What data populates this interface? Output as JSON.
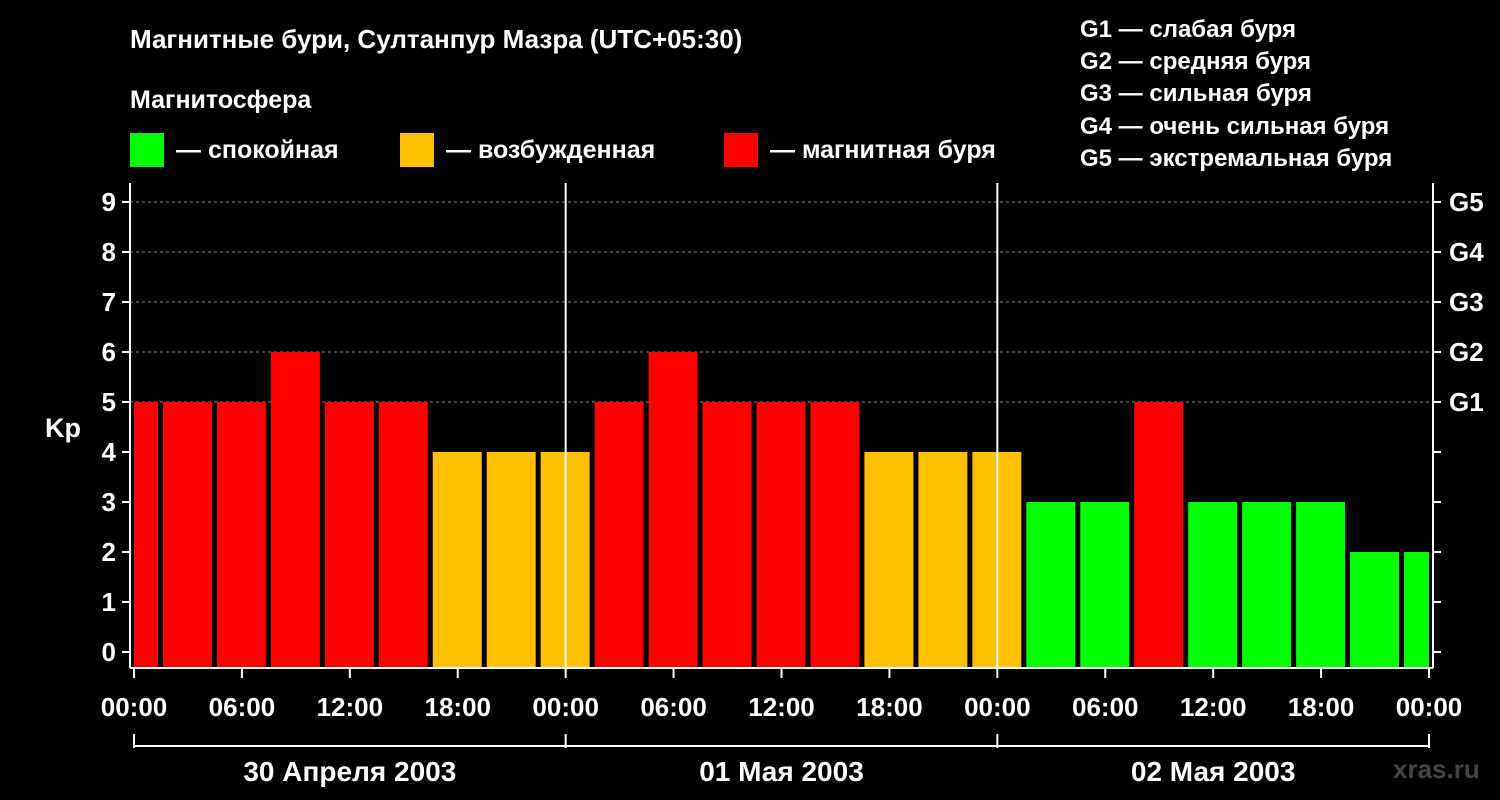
{
  "title": "Магнитные бури, Султанпур Мазра (UTC+05:30)",
  "magnetosphere_label": "Магнитосфера",
  "legend": [
    {
      "label": "— спокойная",
      "color": "#00ff00"
    },
    {
      "label": "— возбужденная",
      "color": "#ffc000"
    },
    {
      "label": "— магнитная буря",
      "color": "#ff0000"
    }
  ],
  "g_scale": [
    "G1 — слабая буря",
    "G2 — средняя буря",
    "G3 — сильная буря",
    "G4 — очень сильная буря",
    "G5 — экстремальная буря"
  ],
  "watermark": "xras.ru",
  "chart_data": {
    "type": "bar",
    "ylabel": "Kp",
    "ylim": [
      0,
      9
    ],
    "y_ticks": [
      0,
      1,
      2,
      3,
      4,
      5,
      6,
      7,
      8,
      9
    ],
    "right_axis_labels": [
      {
        "kp": 5,
        "label": "G1"
      },
      {
        "kp": 6,
        "label": "G2"
      },
      {
        "kp": 7,
        "label": "G3"
      },
      {
        "kp": 8,
        "label": "G4"
      },
      {
        "kp": 9,
        "label": "G5"
      }
    ],
    "x_tick_labels": [
      "00:00",
      "06:00",
      "12:00",
      "18:00",
      "00:00",
      "06:00",
      "12:00",
      "18:00",
      "00:00",
      "06:00",
      "12:00",
      "18:00",
      "00:00"
    ],
    "days": [
      "30 Апреля 2003",
      "01 Мая 2003",
      "02 Мая 2003"
    ],
    "grid": "dashed horizontal at Kp 5-9",
    "colors": {
      "quiet": "#00ff00",
      "active": "#ffc000",
      "storm": "#ff0000"
    },
    "bars": [
      {
        "start_hour": 0,
        "end_hour": 1.5,
        "kp": 5
      },
      {
        "start_hour": 1.5,
        "end_hour": 4.5,
        "kp": 5
      },
      {
        "start_hour": 4.5,
        "end_hour": 7.5,
        "kp": 5
      },
      {
        "start_hour": 7.5,
        "end_hour": 10.5,
        "kp": 6
      },
      {
        "start_hour": 10.5,
        "end_hour": 13.5,
        "kp": 5
      },
      {
        "start_hour": 13.5,
        "end_hour": 16.5,
        "kp": 5
      },
      {
        "start_hour": 16.5,
        "end_hour": 19.5,
        "kp": 4
      },
      {
        "start_hour": 19.5,
        "end_hour": 22.5,
        "kp": 4
      },
      {
        "start_hour": 22.5,
        "end_hour": 25.5,
        "kp": 4
      },
      {
        "start_hour": 25.5,
        "end_hour": 28.5,
        "kp": 5
      },
      {
        "start_hour": 28.5,
        "end_hour": 31.5,
        "kp": 6
      },
      {
        "start_hour": 31.5,
        "end_hour": 34.5,
        "kp": 5
      },
      {
        "start_hour": 34.5,
        "end_hour": 37.5,
        "kp": 5
      },
      {
        "start_hour": 37.5,
        "end_hour": 40.5,
        "kp": 5
      },
      {
        "start_hour": 40.5,
        "end_hour": 43.5,
        "kp": 4
      },
      {
        "start_hour": 43.5,
        "end_hour": 46.5,
        "kp": 4
      },
      {
        "start_hour": 46.5,
        "end_hour": 49.5,
        "kp": 4
      },
      {
        "start_hour": 49.5,
        "end_hour": 52.5,
        "kp": 3
      },
      {
        "start_hour": 52.5,
        "end_hour": 55.5,
        "kp": 3
      },
      {
        "start_hour": 55.5,
        "end_hour": 58.5,
        "kp": 5
      },
      {
        "start_hour": 58.5,
        "end_hour": 61.5,
        "kp": 3
      },
      {
        "start_hour": 61.5,
        "end_hour": 64.5,
        "kp": 3
      },
      {
        "start_hour": 64.5,
        "end_hour": 67.5,
        "kp": 3
      },
      {
        "start_hour": 67.5,
        "end_hour": 70.5,
        "kp": 2
      },
      {
        "start_hour": 70.5,
        "end_hour": 72,
        "kp": 2
      }
    ]
  }
}
